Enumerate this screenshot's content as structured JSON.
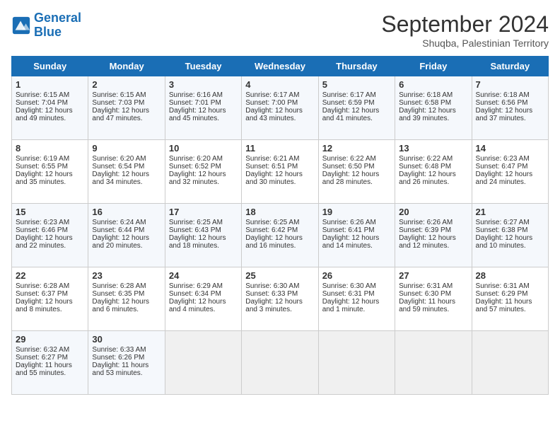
{
  "logo": {
    "line1": "General",
    "line2": "Blue"
  },
  "title": "September 2024",
  "location": "Shuqba, Palestinian Territory",
  "days_of_week": [
    "Sunday",
    "Monday",
    "Tuesday",
    "Wednesday",
    "Thursday",
    "Friday",
    "Saturday"
  ],
  "weeks": [
    [
      {
        "day": "1",
        "lines": [
          "Sunrise: 6:15 AM",
          "Sunset: 7:04 PM",
          "Daylight: 12 hours",
          "and 49 minutes."
        ]
      },
      {
        "day": "2",
        "lines": [
          "Sunrise: 6:15 AM",
          "Sunset: 7:03 PM",
          "Daylight: 12 hours",
          "and 47 minutes."
        ]
      },
      {
        "day": "3",
        "lines": [
          "Sunrise: 6:16 AM",
          "Sunset: 7:01 PM",
          "Daylight: 12 hours",
          "and 45 minutes."
        ]
      },
      {
        "day": "4",
        "lines": [
          "Sunrise: 6:17 AM",
          "Sunset: 7:00 PM",
          "Daylight: 12 hours",
          "and 43 minutes."
        ]
      },
      {
        "day": "5",
        "lines": [
          "Sunrise: 6:17 AM",
          "Sunset: 6:59 PM",
          "Daylight: 12 hours",
          "and 41 minutes."
        ]
      },
      {
        "day": "6",
        "lines": [
          "Sunrise: 6:18 AM",
          "Sunset: 6:58 PM",
          "Daylight: 12 hours",
          "and 39 minutes."
        ]
      },
      {
        "day": "7",
        "lines": [
          "Sunrise: 6:18 AM",
          "Sunset: 6:56 PM",
          "Daylight: 12 hours",
          "and 37 minutes."
        ]
      }
    ],
    [
      {
        "day": "8",
        "lines": [
          "Sunrise: 6:19 AM",
          "Sunset: 6:55 PM",
          "Daylight: 12 hours",
          "and 35 minutes."
        ]
      },
      {
        "day": "9",
        "lines": [
          "Sunrise: 6:20 AM",
          "Sunset: 6:54 PM",
          "Daylight: 12 hours",
          "and 34 minutes."
        ]
      },
      {
        "day": "10",
        "lines": [
          "Sunrise: 6:20 AM",
          "Sunset: 6:52 PM",
          "Daylight: 12 hours",
          "and 32 minutes."
        ]
      },
      {
        "day": "11",
        "lines": [
          "Sunrise: 6:21 AM",
          "Sunset: 6:51 PM",
          "Daylight: 12 hours",
          "and 30 minutes."
        ]
      },
      {
        "day": "12",
        "lines": [
          "Sunrise: 6:22 AM",
          "Sunset: 6:50 PM",
          "Daylight: 12 hours",
          "and 28 minutes."
        ]
      },
      {
        "day": "13",
        "lines": [
          "Sunrise: 6:22 AM",
          "Sunset: 6:48 PM",
          "Daylight: 12 hours",
          "and 26 minutes."
        ]
      },
      {
        "day": "14",
        "lines": [
          "Sunrise: 6:23 AM",
          "Sunset: 6:47 PM",
          "Daylight: 12 hours",
          "and 24 minutes."
        ]
      }
    ],
    [
      {
        "day": "15",
        "lines": [
          "Sunrise: 6:23 AM",
          "Sunset: 6:46 PM",
          "Daylight: 12 hours",
          "and 22 minutes."
        ]
      },
      {
        "day": "16",
        "lines": [
          "Sunrise: 6:24 AM",
          "Sunset: 6:44 PM",
          "Daylight: 12 hours",
          "and 20 minutes."
        ]
      },
      {
        "day": "17",
        "lines": [
          "Sunrise: 6:25 AM",
          "Sunset: 6:43 PM",
          "Daylight: 12 hours",
          "and 18 minutes."
        ]
      },
      {
        "day": "18",
        "lines": [
          "Sunrise: 6:25 AM",
          "Sunset: 6:42 PM",
          "Daylight: 12 hours",
          "and 16 minutes."
        ]
      },
      {
        "day": "19",
        "lines": [
          "Sunrise: 6:26 AM",
          "Sunset: 6:41 PM",
          "Daylight: 12 hours",
          "and 14 minutes."
        ]
      },
      {
        "day": "20",
        "lines": [
          "Sunrise: 6:26 AM",
          "Sunset: 6:39 PM",
          "Daylight: 12 hours",
          "and 12 minutes."
        ]
      },
      {
        "day": "21",
        "lines": [
          "Sunrise: 6:27 AM",
          "Sunset: 6:38 PM",
          "Daylight: 12 hours",
          "and 10 minutes."
        ]
      }
    ],
    [
      {
        "day": "22",
        "lines": [
          "Sunrise: 6:28 AM",
          "Sunset: 6:37 PM",
          "Daylight: 12 hours",
          "and 8 minutes."
        ]
      },
      {
        "day": "23",
        "lines": [
          "Sunrise: 6:28 AM",
          "Sunset: 6:35 PM",
          "Daylight: 12 hours",
          "and 6 minutes."
        ]
      },
      {
        "day": "24",
        "lines": [
          "Sunrise: 6:29 AM",
          "Sunset: 6:34 PM",
          "Daylight: 12 hours",
          "and 4 minutes."
        ]
      },
      {
        "day": "25",
        "lines": [
          "Sunrise: 6:30 AM",
          "Sunset: 6:33 PM",
          "Daylight: 12 hours",
          "and 3 minutes."
        ]
      },
      {
        "day": "26",
        "lines": [
          "Sunrise: 6:30 AM",
          "Sunset: 6:31 PM",
          "Daylight: 12 hours",
          "and 1 minute."
        ]
      },
      {
        "day": "27",
        "lines": [
          "Sunrise: 6:31 AM",
          "Sunset: 6:30 PM",
          "Daylight: 11 hours",
          "and 59 minutes."
        ]
      },
      {
        "day": "28",
        "lines": [
          "Sunrise: 6:31 AM",
          "Sunset: 6:29 PM",
          "Daylight: 11 hours",
          "and 57 minutes."
        ]
      }
    ],
    [
      {
        "day": "29",
        "lines": [
          "Sunrise: 6:32 AM",
          "Sunset: 6:27 PM",
          "Daylight: 11 hours",
          "and 55 minutes."
        ]
      },
      {
        "day": "30",
        "lines": [
          "Sunrise: 6:33 AM",
          "Sunset: 6:26 PM",
          "Daylight: 11 hours",
          "and 53 minutes."
        ]
      },
      null,
      null,
      null,
      null,
      null
    ]
  ]
}
